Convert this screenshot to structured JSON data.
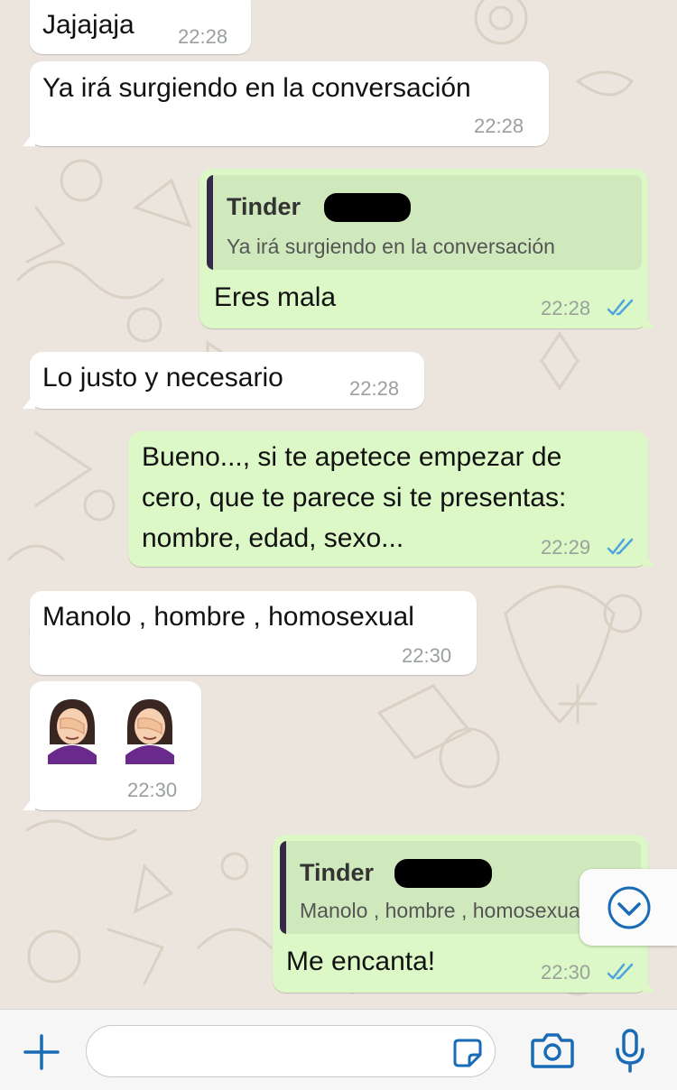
{
  "colors": {
    "accent": "#1a6bb5",
    "incoming": "#ffffff",
    "outgoing": "#dcf8c6",
    "read_ticks": "#4fa3e0"
  },
  "messages": [
    {
      "text": "Jajajaja",
      "time": "22:28"
    },
    {
      "text": "Ya irá surgiendo en la conversación",
      "time": "22:28"
    },
    {
      "quote_title": "Tinder",
      "quote_text": "Ya irá surgiendo en la conversación",
      "text": "Eres mala",
      "time": "22:28"
    },
    {
      "text": "Lo justo y necesario",
      "time": "22:28"
    },
    {
      "lines": [
        "Bueno..., si te apetece empezar de",
        "cero, que te parece si te presentas:",
        "nombre, edad, sexo..."
      ],
      "time": "22:29"
    },
    {
      "text": "Manolo , hombre , homosexual",
      "time": "22:30"
    },
    {
      "emoji": "woman-facepalming",
      "time": "22:30"
    },
    {
      "quote_title": "Tinder",
      "quote_text": "Manolo , hombre , homosexual",
      "text": "Me encanta!",
      "time": "22:30"
    }
  ],
  "input": {
    "placeholder": ""
  },
  "icons": [
    "plus-icon",
    "sticker-icon",
    "camera-icon",
    "microphone-icon",
    "scroll-down-icon"
  ]
}
